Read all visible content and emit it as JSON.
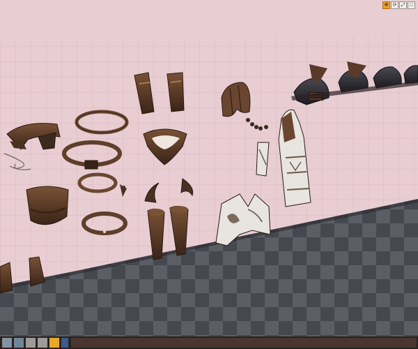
{
  "viewport": {
    "scene": "3d-asset-viewer",
    "floor_grid": "pink",
    "ground": "checker-grey",
    "colors": {
      "sky_pink": "#e8cdd3",
      "grid_line": "#d4a9b3",
      "checker_dark": "#3b3e44",
      "checker_light": "#5a5d63",
      "leather_brown": "#5a3a28",
      "metal_dark": "#2d2a2c",
      "cloth_white": "#e8e4df"
    }
  },
  "toolbar": {
    "buttons": [
      {
        "icon": "translate-icon",
        "active": true
      },
      {
        "icon": "rotate-icon",
        "active": false
      },
      {
        "icon": "scale-icon",
        "active": false
      },
      {
        "icon": "maximize-icon",
        "active": false
      }
    ]
  },
  "assets": [
    {
      "name": "pauldron-left"
    },
    {
      "name": "chain-strap"
    },
    {
      "name": "belt-thin"
    },
    {
      "name": "belt-buckle"
    },
    {
      "name": "collar-ring"
    },
    {
      "name": "bracer-wide"
    },
    {
      "name": "studded-collar"
    },
    {
      "name": "greave-left"
    },
    {
      "name": "greave-right"
    },
    {
      "name": "vambrace-left"
    },
    {
      "name": "vambrace-right"
    },
    {
      "name": "loincloth-plate"
    },
    {
      "name": "spike-left"
    },
    {
      "name": "spike-right"
    },
    {
      "name": "boot-left"
    },
    {
      "name": "boot-right"
    },
    {
      "name": "hair-helmet"
    },
    {
      "name": "hair-braid"
    },
    {
      "name": "tassel"
    },
    {
      "name": "cloth-strip"
    },
    {
      "name": "tabard"
    },
    {
      "name": "cloth-vest"
    },
    {
      "name": "helmet-visor"
    },
    {
      "name": "helmet-1"
    },
    {
      "name": "helmet-2"
    },
    {
      "name": "helmet-3"
    }
  ]
}
